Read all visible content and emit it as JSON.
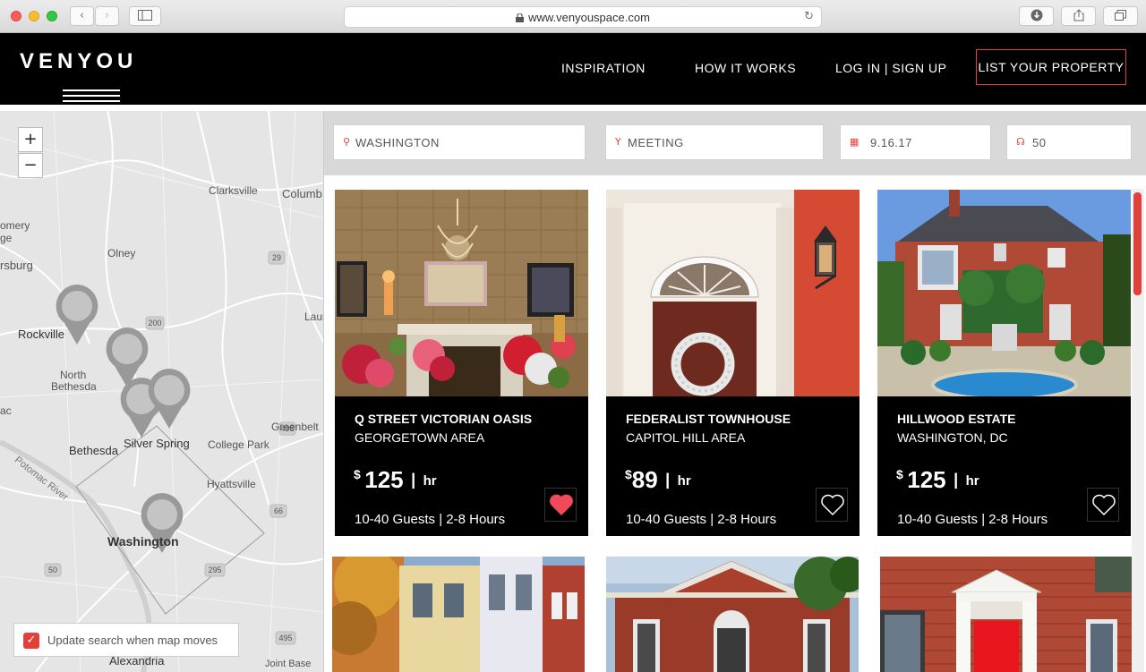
{
  "browser": {
    "url": "www.venyouspace.com"
  },
  "header": {
    "logo_text": "VENYOU",
    "nav": [
      "INSPIRATION",
      "HOW IT WORKS",
      "LOG IN | SIGN UP"
    ],
    "cta": "LIST YOUR PROPERTY",
    "accent": "#e2403a"
  },
  "map": {
    "labels": [
      "Clarksville",
      "Columb",
      "omery",
      "ge",
      "rsburg",
      "Olney",
      "Rockville",
      "North",
      "Bethesda",
      "Laur",
      "ac",
      "Bethesda",
      "Silver Spring",
      "Greenbelt",
      "College Park",
      "Potomac River",
      "Hyattsville",
      "Washington",
      "Alexandria",
      "Joint Base"
    ],
    "road_markers": [
      "29",
      "200",
      "495",
      "50",
      "295",
      "66",
      "495"
    ],
    "zoom_in": "+",
    "zoom_out": "−",
    "update_search_label": "Update search when map moves",
    "update_search_checked": true
  },
  "filters": {
    "location": "WASHINGTON",
    "event_type": "MEETING",
    "date": "9.16.17",
    "guests": "50"
  },
  "listings": [
    {
      "title": "Q STREET VICTORIAN OASIS",
      "area": "GEORGETOWN AREA",
      "currency": "$",
      "price": "125",
      "unit": "hr",
      "guests": "10-40 Guests",
      "hours": "2-8 Hours",
      "favorited": true,
      "photo_icon": "victorian-parlor"
    },
    {
      "title": "FEDERALIST TOWNHOUSE",
      "area": "CAPITOL HILL AREA",
      "currency": "$",
      "price": "89",
      "unit": "hr",
      "guests": "10-40 Guests",
      "hours": "2-8 Hours",
      "favorited": false,
      "photo_icon": "townhouse-door-wreath"
    },
    {
      "title": "HILLWOOD ESTATE",
      "area": "WASHINGTON, DC",
      "currency": "$",
      "price": "125",
      "unit": "hr",
      "guests": "10-40 Guests",
      "hours": "2-8 Hours",
      "favorited": false,
      "photo_icon": "brick-estate-fountain"
    }
  ]
}
